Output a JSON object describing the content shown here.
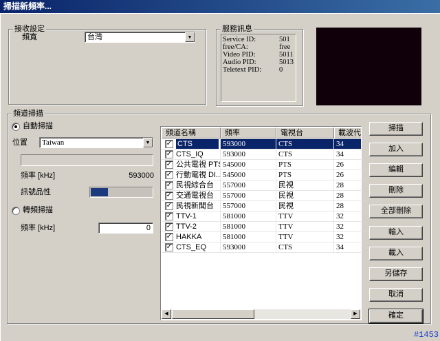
{
  "window": {
    "title": "掃描新頻率..."
  },
  "reception": {
    "legend": "接收設定",
    "bandwidth_label": "頻寬",
    "bandwidth_value": "台灣"
  },
  "service_info": {
    "legend": "服務訊息",
    "rows": [
      {
        "label": "Service ID:",
        "value": "501"
      },
      {
        "label": "free/CA:",
        "value": "free"
      },
      {
        "label": "Video PID:",
        "value": "5011"
      },
      {
        "label": "Audio PID:",
        "value": "5013"
      },
      {
        "label": "Teletext PID:",
        "value": "0"
      }
    ]
  },
  "channel_scan": {
    "legend": "頻道掃描",
    "auto_scan_label": "自動掃描",
    "auto_scan_selected": true,
    "position_label": "位置",
    "position_value": "Taiwan",
    "frequency_label": "頻率 [kHz]",
    "frequency_value": "593000",
    "signal_quality_label": "訊號品性",
    "signal_quality_level": 0.28,
    "manual_scan_label": "轉頻掃描",
    "manual_scan_selected": false,
    "manual_frequency_label": "頻率 [kHz]",
    "manual_frequency_value": "0"
  },
  "channel_list": {
    "columns": [
      "頻道名稱",
      "頻率",
      "電視台",
      "載波代號"
    ],
    "rows": [
      {
        "checked": true,
        "name": "CTS",
        "freq": "593000",
        "station": "CTS",
        "carrier": "34",
        "selected": true
      },
      {
        "checked": true,
        "name": "CTS_IQ",
        "freq": "593000",
        "station": "CTS",
        "carrier": "34"
      },
      {
        "checked": true,
        "name": "公共電視 PTS",
        "freq": "545000",
        "station": "PTS",
        "carrier": "26"
      },
      {
        "checked": true,
        "name": "行動電視 DI...",
        "freq": "545000",
        "station": "PTS",
        "carrier": "26"
      },
      {
        "checked": true,
        "name": "民視綜合台",
        "freq": "557000",
        "station": "民視",
        "carrier": "28"
      },
      {
        "checked": true,
        "name": "交通電視台",
        "freq": "557000",
        "station": "民視",
        "carrier": "28"
      },
      {
        "checked": true,
        "name": "民視新聞台",
        "freq": "557000",
        "station": "民視",
        "carrier": "28"
      },
      {
        "checked": true,
        "name": "TTV-1",
        "freq": "581000",
        "station": "TTV",
        "carrier": "32"
      },
      {
        "checked": true,
        "name": "TTV-2",
        "freq": "581000",
        "station": "TTV",
        "carrier": "32"
      },
      {
        "checked": true,
        "name": "HAKKA",
        "freq": "581000",
        "station": "TTV",
        "carrier": "32"
      },
      {
        "checked": true,
        "name": "CTS_EQ",
        "freq": "593000",
        "station": "CTS",
        "carrier": "34"
      }
    ]
  },
  "buttons": {
    "scan": "掃描",
    "add": "加入",
    "edit": "編輯",
    "delete": "刪除",
    "delete_all": "全部刪除",
    "import": "輸入",
    "load": "載入",
    "save_as": "另儲存",
    "cancel": "取消",
    "ok": "確定"
  },
  "corner_tag": "#1453"
}
